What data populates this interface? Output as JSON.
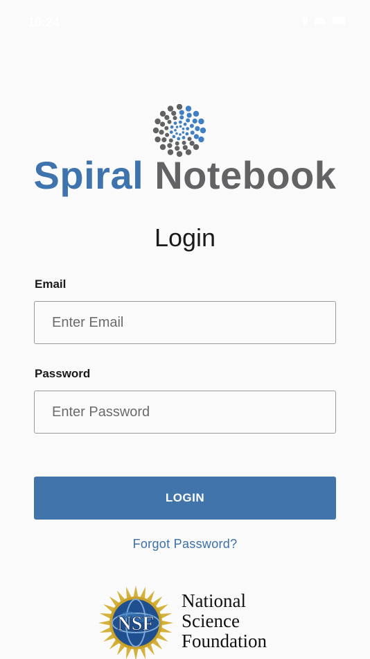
{
  "status_bar": {
    "time": "10:24",
    "icons": [
      "signal-icon",
      "wifi-icon",
      "battery-icon"
    ]
  },
  "brand": {
    "word1": "Spiral",
    "word2": "Notebook",
    "word1_color": "#3f73ad",
    "word2_color": "#636366",
    "mark_icon": "spiral-dots-logo"
  },
  "login": {
    "title": "Login",
    "email_label": "Email",
    "email_placeholder": "Enter Email",
    "email_value": "",
    "password_label": "Password",
    "password_placeholder": "Enter Password",
    "password_value": "",
    "button_label": "LOGIN",
    "button_color": "#4174ab",
    "forgot_label": "Forgot Password?"
  },
  "footer": {
    "logo_icon": "nsf-globe-logo",
    "logo_text": "NSF",
    "org_lines": [
      "National",
      "Science",
      "Foundation"
    ]
  }
}
